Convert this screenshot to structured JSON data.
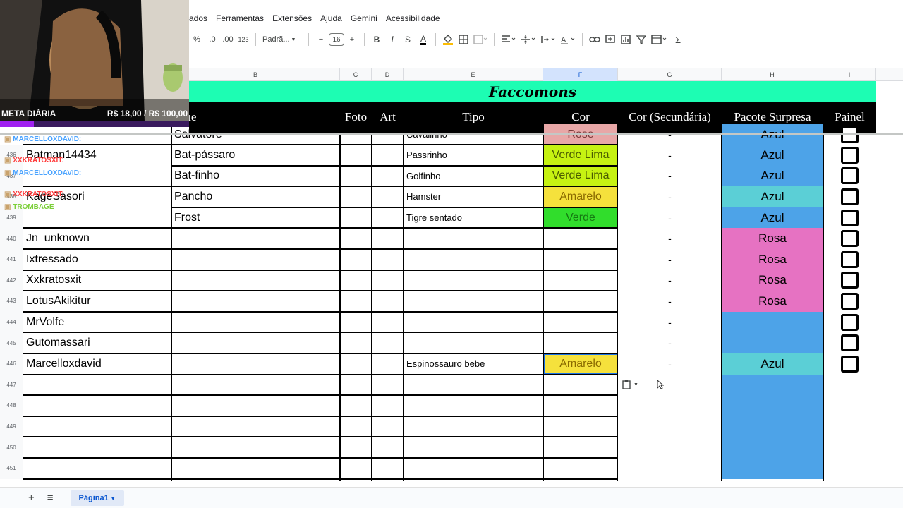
{
  "menu": [
    "ados",
    "Ferramentas",
    "Extensões",
    "Ajuda",
    "Gemini",
    "Acessibilidade"
  ],
  "toolbar": {
    "percent": "%",
    "dec_less": ".0",
    "dec_more": ".00",
    "number_format": "123",
    "font": "Padrã...",
    "font_size": "16",
    "minus": "−",
    "plus": "+",
    "bold": "B",
    "italic": "I",
    "strike": "S",
    "text_color": "A",
    "sum": "Σ"
  },
  "columns": [
    "B",
    "C",
    "D",
    "E",
    "F",
    "G",
    "H",
    "I"
  ],
  "sheet_title": "Faccomons",
  "headers": {
    "name_partial": "me",
    "foto": "Foto",
    "art": "Art",
    "tipo": "Tipo",
    "cor": "Cor",
    "cor_sec": "Cor (Secundária)",
    "pacote": "Pacote Surpresa",
    "painel": "Painel"
  },
  "partial_row": {
    "b": "Salvatore",
    "tipo": "Cavalinho",
    "cor": "Rose",
    "g": "-",
    "pacote": "Azul"
  },
  "rows": [
    {
      "num": "436",
      "a": "Batman14434",
      "b": "Bat-pássaro",
      "tipo": "Passrinho",
      "cor": "Verde Lima",
      "cor_bg": "#c6f212",
      "cor_fg": "#4a5a00",
      "g": "-",
      "pacote": "Azul",
      "pac_bg": "#4da3e8"
    },
    {
      "num": "437",
      "a": "",
      "b": "Bat-finho",
      "tipo": "Golfinho",
      "cor": "Verde Lima",
      "cor_bg": "#c6f212",
      "cor_fg": "#4a5a00",
      "g": "-",
      "pacote": "Azul",
      "pac_bg": "#4da3e8"
    },
    {
      "num": "438",
      "a": "KageSasori",
      "b": "Pancho",
      "tipo": "Hamster",
      "cor": "Amarelo",
      "cor_bg": "#f5e13c",
      "cor_fg": "#8a6a00",
      "g": "-",
      "pacote": "Azul",
      "pac_bg": "#5bcfd6"
    },
    {
      "num": "439",
      "a": "",
      "b": "Frost",
      "tipo": "Tigre sentado",
      "cor": "Verde",
      "cor_bg": "#31dd2c",
      "cor_fg": "#157a12",
      "g": "-",
      "pacote": "Azul",
      "pac_bg": "#4da3e8"
    },
    {
      "num": "440",
      "a": "Jn_unknown",
      "b": "",
      "tipo": "",
      "cor": "",
      "cor_bg": "",
      "cor_fg": "",
      "g": "-",
      "pacote": "Rosa",
      "pac_bg": "#e672c2"
    },
    {
      "num": "441",
      "a": "Ixtressado",
      "b": "",
      "tipo": "",
      "cor": "",
      "cor_bg": "",
      "cor_fg": "",
      "g": "-",
      "pacote": "Rosa",
      "pac_bg": "#e672c2"
    },
    {
      "num": "442",
      "a": "Xxkratosxit",
      "b": "",
      "tipo": "",
      "cor": "",
      "cor_bg": "",
      "cor_fg": "",
      "g": "-",
      "pacote": "Rosa",
      "pac_bg": "#e672c2"
    },
    {
      "num": "443",
      "a": "LotusAkikitur",
      "b": "",
      "tipo": "",
      "cor": "",
      "cor_bg": "",
      "cor_fg": "",
      "g": "-",
      "pacote": "Rosa",
      "pac_bg": "#e672c2"
    },
    {
      "num": "444",
      "a": "MrVolfe",
      "b": "",
      "tipo": "",
      "cor": "",
      "cor_bg": "",
      "cor_fg": "",
      "g": "-",
      "pacote": "",
      "pac_bg": "#4da3e8"
    },
    {
      "num": "445",
      "a": "Gutomassari",
      "b": "",
      "tipo": "",
      "cor": "",
      "cor_bg": "",
      "cor_fg": "",
      "g": "-",
      "pacote": "",
      "pac_bg": "#4da3e8"
    },
    {
      "num": "446",
      "a": "Marcelloxdavid",
      "b": "",
      "tipo": "Espinossauro bebe",
      "cor": "Amarelo",
      "cor_bg": "#f5e13c",
      "cor_fg": "#8a6a00",
      "g": "-",
      "pacote": "Azul",
      "pac_bg": "#5bcfd6"
    },
    {
      "num": "447",
      "a": "",
      "b": "",
      "tipo": "",
      "cor": "",
      "cor_bg": "",
      "cor_fg": "",
      "g": "",
      "pacote": "",
      "pac_bg": "#4da3e8"
    },
    {
      "num": "448",
      "a": "",
      "b": "",
      "tipo": "",
      "cor": "",
      "cor_bg": "",
      "cor_fg": "",
      "g": "",
      "pacote": "",
      "pac_bg": "#4da3e8"
    },
    {
      "num": "449",
      "a": "",
      "b": "",
      "tipo": "",
      "cor": "",
      "cor_bg": "",
      "cor_fg": "",
      "g": "",
      "pacote": "",
      "pac_bg": "#4da3e8"
    },
    {
      "num": "450",
      "a": "",
      "b": "",
      "tipo": "",
      "cor": "",
      "cor_bg": "",
      "cor_fg": "",
      "g": "",
      "pacote": "",
      "pac_bg": "#4da3e8"
    },
    {
      "num": "451",
      "a": "",
      "b": "",
      "tipo": "",
      "cor": "",
      "cor_bg": "",
      "cor_fg": "",
      "g": "",
      "pacote": "",
      "pac_bg": "#4da3e8"
    }
  ],
  "stream": {
    "meta_label": "META DIÁRIA",
    "meta_amount": "R$ 18,00 / R$ 100,00",
    "meta_progress": 0.18,
    "chat": [
      {
        "user": "MARCELLOXDAVID:",
        "color": "#4aa3ff"
      },
      {
        "user": "XXKRATOSXIT:",
        "color": "#ff3b3b"
      },
      {
        "user": "MARCELLOXDAVID:",
        "color": "#4aa3ff"
      },
      {
        "user": "XXKRATOSXIT:",
        "color": "#ff3b3b"
      },
      {
        "user": "TROMBAGE",
        "color": "#7ccf3a"
      }
    ]
  },
  "bottom": {
    "add": "+",
    "menu": "≡",
    "sheet_tab": "Página1"
  }
}
